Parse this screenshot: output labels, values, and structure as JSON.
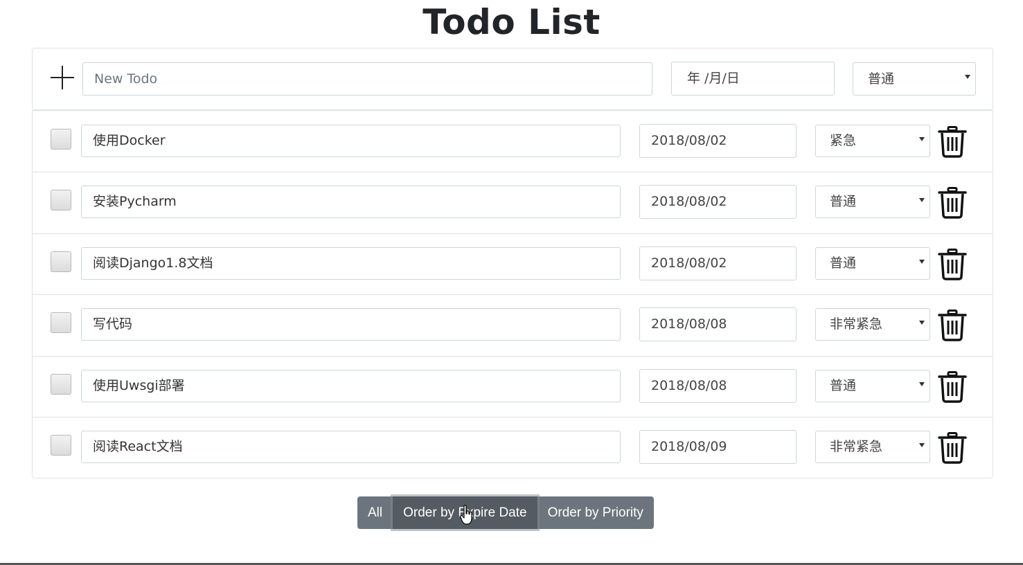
{
  "page_title": "Todo List",
  "new_todo": {
    "placeholder": "New Todo",
    "date_placeholder": "年 /月/日",
    "priority": "普通"
  },
  "todos": [
    {
      "text": "使用Docker",
      "date": "2018/08/02",
      "priority": "紧急"
    },
    {
      "text": "安装Pycharm",
      "date": "2018/08/02",
      "priority": "普通"
    },
    {
      "text": "阅读Django1.8文档",
      "date": "2018/08/02",
      "priority": "普通"
    },
    {
      "text": "写代码",
      "date": "2018/08/08",
      "priority": "非常紧急"
    },
    {
      "text": "使用Uwsgi部署",
      "date": "2018/08/08",
      "priority": "普通"
    },
    {
      "text": "阅读React文档",
      "date": "2018/08/09",
      "priority": "非常紧急"
    }
  ],
  "filters": {
    "all": "All",
    "order_expire": "Order by Expire Date",
    "order_priority": "Order by Priority",
    "active": "order_expire"
  },
  "colors": {
    "button": "#6c757d",
    "button_active": "#545b62",
    "border": "#dfe2e5"
  },
  "icons": [
    "plus-icon",
    "trash-icon",
    "hand-cursor-icon"
  ]
}
